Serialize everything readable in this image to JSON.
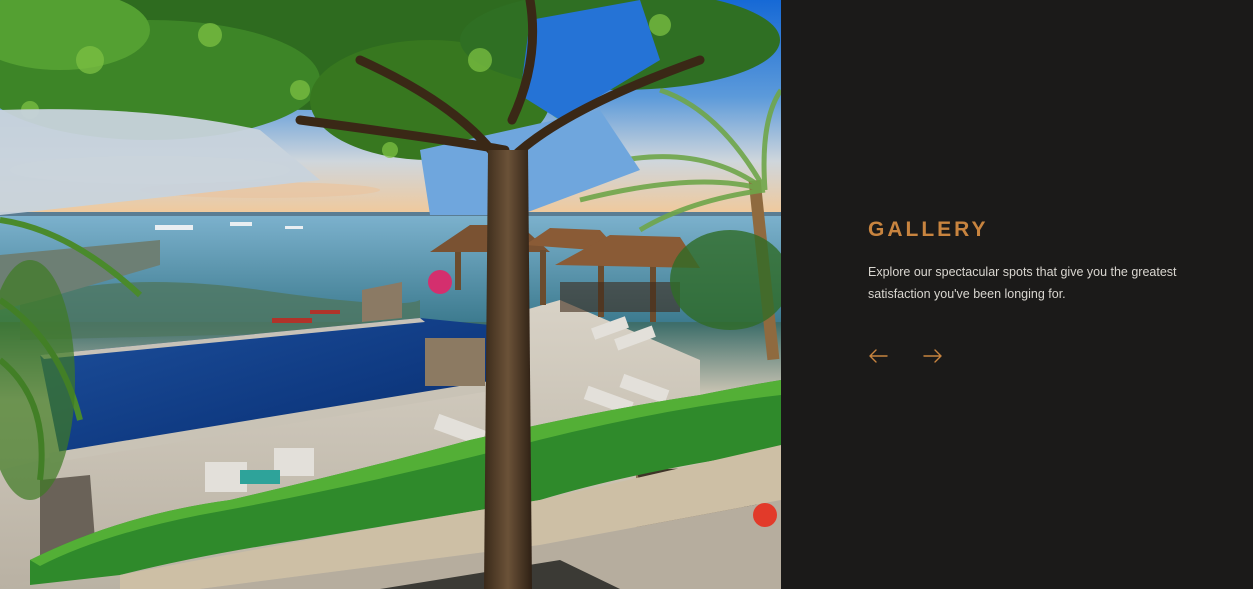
{
  "gallery": {
    "title": "GALLERY",
    "description": "Explore our spectacular spots that give you the greatest satisfaction you've been longing for.",
    "accent_color": "#c8843f",
    "background_color": "#1b1a19"
  },
  "photo": {
    "subject": "resort-infinity-pool-ocean-view"
  },
  "navigation": {
    "prev_icon": "arrow-left-icon",
    "next_icon": "arrow-right-icon"
  }
}
